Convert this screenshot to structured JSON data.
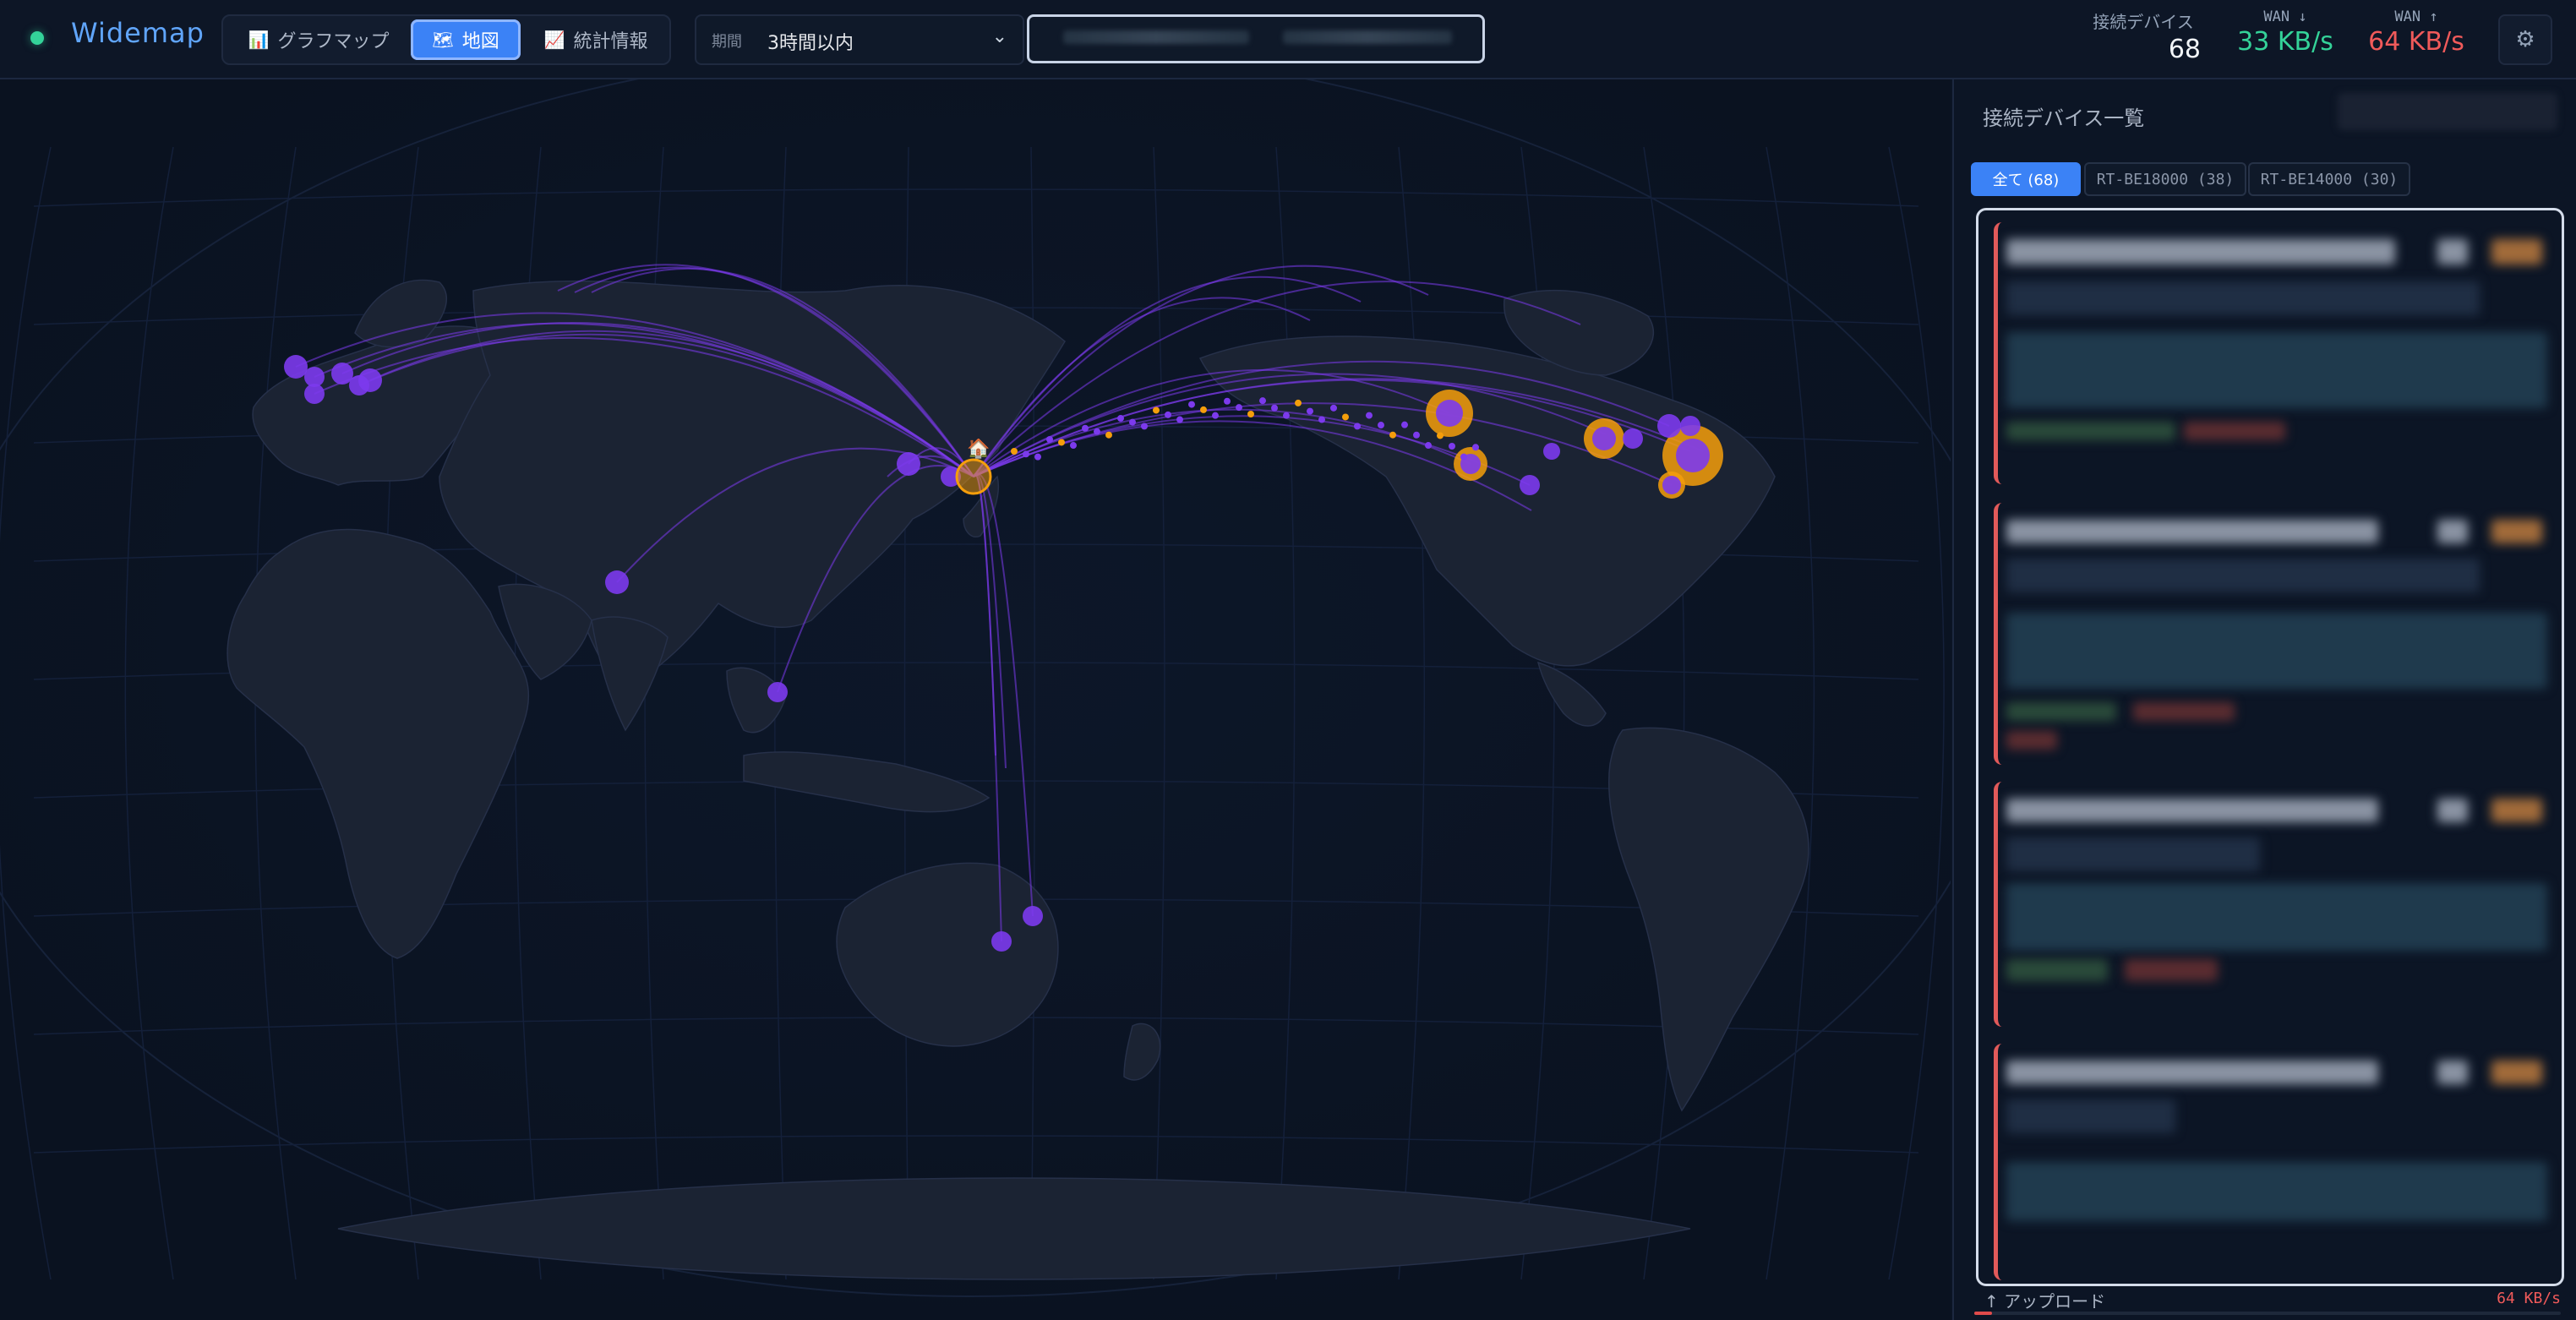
{
  "app": {
    "title": "Widemap",
    "status": "online"
  },
  "views": [
    {
      "label": "グラフマップ",
      "icon": "bar-chart-icon",
      "active": false
    },
    {
      "label": "地図",
      "icon": "map-icon",
      "active": true
    },
    {
      "label": "統計情報",
      "icon": "line-chart-icon",
      "active": false
    }
  ],
  "period": {
    "label": "期間",
    "value": "3時間以内"
  },
  "search": {
    "placeholder": ""
  },
  "stats": {
    "devices": {
      "label": "接続デバイス",
      "value": "68"
    },
    "wan_down": {
      "label": "WAN ↓",
      "value": "33 KB/s",
      "color": "#34d399"
    },
    "wan_up": {
      "label": "WAN ↑",
      "value": "64 KB/s",
      "color": "#f05a5a"
    }
  },
  "settings": {
    "icon": "gear-icon"
  },
  "panel": {
    "title": "接続デバイス一覧",
    "tabs": [
      {
        "label": "全て (68)",
        "active": true
      },
      {
        "label": "RT-BE18000 (38)",
        "active": false
      },
      {
        "label": "RT-BE14000 (30)",
        "active": false
      }
    ]
  },
  "upload": {
    "label": "アップロード",
    "value": "64 KB/s",
    "level": 0.03
  },
  "map": {
    "home": "Tokyo",
    "colors": {
      "ocean": "#0b1424",
      "land": "#1a2233",
      "remote": "#7c3aed",
      "hub": "#f59e0b"
    }
  }
}
